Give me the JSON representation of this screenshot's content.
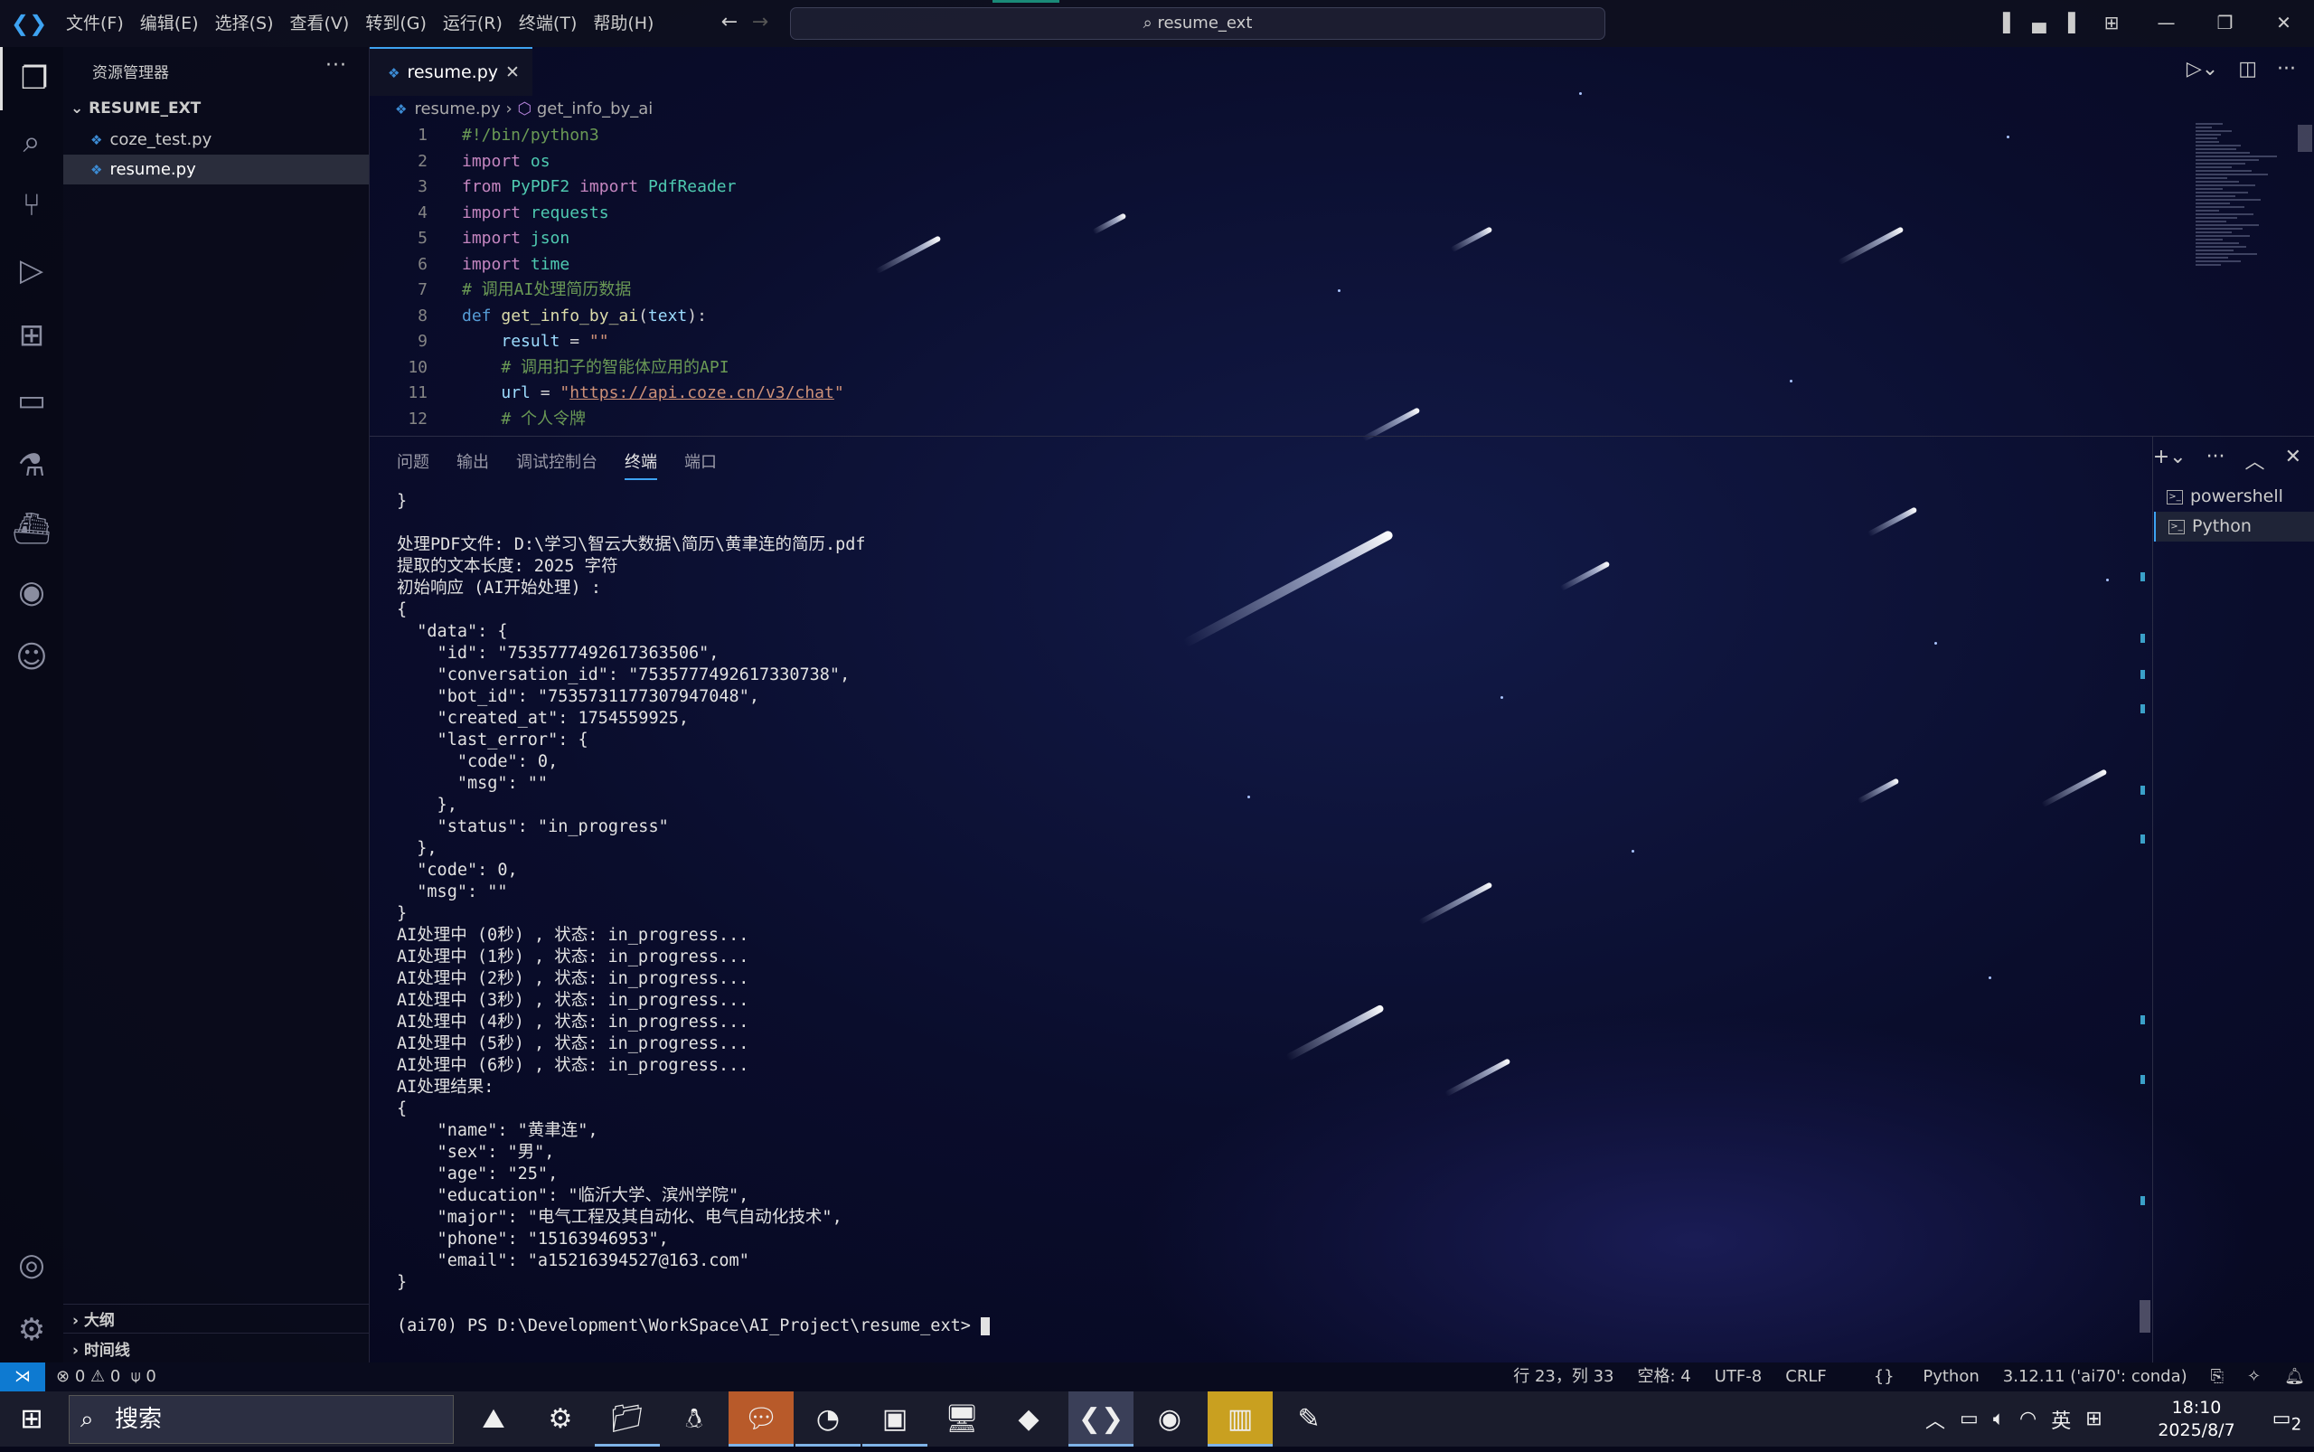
{
  "titlebar": {
    "menu": [
      "文件(F)",
      "编辑(E)",
      "选择(S)",
      "查看(V)",
      "转到(G)",
      "运行(R)",
      "终端(T)",
      "帮助(H)"
    ],
    "search_text": "resume_ext",
    "search_icon": "search-icon"
  },
  "activity_icons": [
    "explorer-icon",
    "search-icon",
    "source-control-icon",
    "run-debug-icon",
    "extensions-icon",
    "remote-explorer-icon",
    "testing-icon",
    "docker-icon",
    "github-icon",
    "copilot-icon",
    "account-icon",
    "settings-icon"
  ],
  "sidebar": {
    "header": "资源管理器",
    "more": "···",
    "folder": "RESUME_EXT",
    "files": [
      "coze_test.py",
      "resume.py"
    ],
    "selected_file": "resume.py",
    "sections": [
      "大纲",
      "时间线"
    ]
  },
  "editor": {
    "tab_label": "resume.py",
    "tab_close": "✕",
    "breadcrumb_file": "resume.py",
    "breadcrumb_symbol": "get_info_by_ai",
    "lines": [
      "1",
      "2",
      "3",
      "4",
      "5",
      "6",
      "7",
      "8",
      "9",
      "10",
      "11",
      "12"
    ],
    "code": {
      "l1": "#!/bin/python3",
      "l2_kw": "import",
      "l2_mod": "os",
      "l3_kw1": "from",
      "l3_mod": "PyPDF2",
      "l3_kw2": "import",
      "l3_cls": "PdfReader",
      "l4_kw": "import",
      "l4_mod": "requests",
      "l5_kw": "import",
      "l5_mod": "json",
      "l6_kw": "import",
      "l6_mod": "time",
      "l7": "# 调用AI处理简历数据",
      "l8_kw": "def",
      "l8_fn": "get_info_by_ai",
      "l8_param": "text",
      "l9_var": "result",
      "l9_val": "\"\"",
      "l10": "# 调用扣子的智能体应用的API",
      "l11_var": "url",
      "l11_val": "https://api.coze.cn/v3/chat",
      "l12": "# 个人令牌"
    }
  },
  "panel": {
    "tabs": [
      "问题",
      "输出",
      "调试控制台",
      "终端",
      "端口"
    ],
    "active_tab": "终端",
    "terminal_lines": [
      "}",
      "",
      "处理PDF文件: D:\\学习\\智云大数据\\简历\\黄聿连的简历.pdf",
      "提取的文本长度: 2025 字符",
      "初始响应 (AI开始处理) :",
      "{",
      "  \"data\": {",
      "    \"id\": \"7535777492617363506\",",
      "    \"conversation_id\": \"7535777492617330738\",",
      "    \"bot_id\": \"7535731177307947048\",",
      "    \"created_at\": 1754559925,",
      "    \"last_error\": {",
      "      \"code\": 0,",
      "      \"msg\": \"\"",
      "    },",
      "    \"status\": \"in_progress\"",
      "  },",
      "  \"code\": 0,",
      "  \"msg\": \"\"",
      "}",
      "AI处理中 (0秒) , 状态: in_progress...",
      "AI处理中 (1秒) , 状态: in_progress...",
      "AI处理中 (2秒) , 状态: in_progress...",
      "AI处理中 (3秒) , 状态: in_progress...",
      "AI处理中 (4秒) , 状态: in_progress...",
      "AI处理中 (5秒) , 状态: in_progress...",
      "AI处理中 (6秒) , 状态: in_progress...",
      "AI处理结果:",
      "{",
      "    \"name\": \"黄聿连\",",
      "    \"sex\": \"男\",",
      "    \"age\": \"25\",",
      "    \"education\": \"临沂大学、滨州学院\",",
      "    \"major\": \"电气工程及其自动化、电气自动化技术\",",
      "    \"phone\": \"15163946953\",",
      "    \"email\": \"a15216394527@163.com\"",
      "}"
    ],
    "prompt": "(ai70) PS D:\\Development\\WorkSpace\\AI_Project\\resume_ext> ",
    "terminals": [
      "powershell",
      "Python"
    ],
    "selected_terminal": "Python"
  },
  "statusbar": {
    "errors": "0",
    "warnings": "0",
    "ports": "0",
    "position": "行 23，列 33",
    "spaces": "空格: 4",
    "encoding": "UTF-8",
    "eol": "CRLF",
    "language": "Python",
    "interpreter": "3.12.11 ('ai70': conda)"
  },
  "taskbar": {
    "search_placeholder": "搜索",
    "time": "18:10",
    "date": "2025/8/7",
    "ime": "英",
    "notification_count": "2"
  }
}
